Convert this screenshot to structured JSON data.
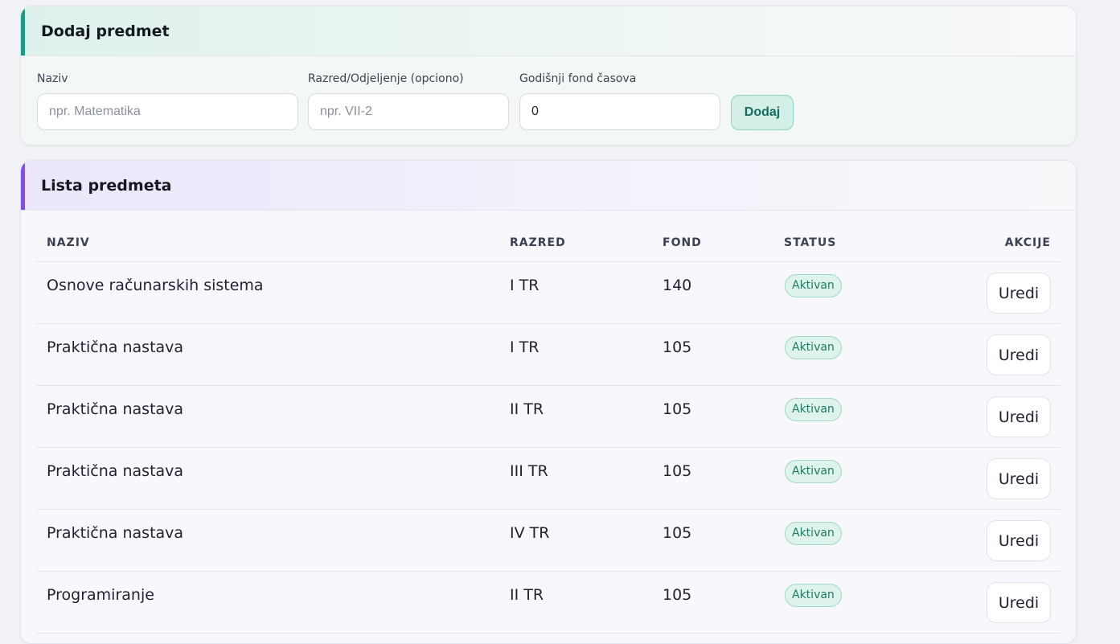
{
  "add_form": {
    "title": "Dodaj predmet",
    "fields": {
      "name": {
        "label": "Naziv",
        "placeholder": "npr. Matematika",
        "value": ""
      },
      "class": {
        "label": "Razred/Odjeljenje (opciono)",
        "placeholder": "npr. VII-2",
        "value": ""
      },
      "hours": {
        "label": "Godišnji fond časova",
        "placeholder": "",
        "value": "0"
      }
    },
    "submit_label": "Dodaj"
  },
  "list": {
    "title": "Lista predmeta",
    "columns": {
      "name": "NAZIV",
      "class": "RAZRED",
      "fund": "FOND",
      "status": "STATUS",
      "actions": "AKCIJE"
    },
    "rows": [
      {
        "name": "Osnove računarskih sistema",
        "class": "I TR",
        "fund": "140",
        "status": "Aktivan",
        "action": "Uredi"
      },
      {
        "name": "Praktična nastava",
        "class": "I TR",
        "fund": "105",
        "status": "Aktivan",
        "action": "Uredi"
      },
      {
        "name": "Praktična nastava",
        "class": "II TR",
        "fund": "105",
        "status": "Aktivan",
        "action": "Uredi"
      },
      {
        "name": "Praktična nastava",
        "class": "III TR",
        "fund": "105",
        "status": "Aktivan",
        "action": "Uredi"
      },
      {
        "name": "Praktična nastava",
        "class": "IV TR",
        "fund": "105",
        "status": "Aktivan",
        "action": "Uredi"
      },
      {
        "name": "Programiranje",
        "class": "II TR",
        "fund": "105",
        "status": "Aktivan",
        "action": "Uredi"
      }
    ]
  },
  "colors": {
    "add_accent": "#1f9a84",
    "list_accent": "#7e4fe0",
    "status_active": "#1f7a5f"
  }
}
